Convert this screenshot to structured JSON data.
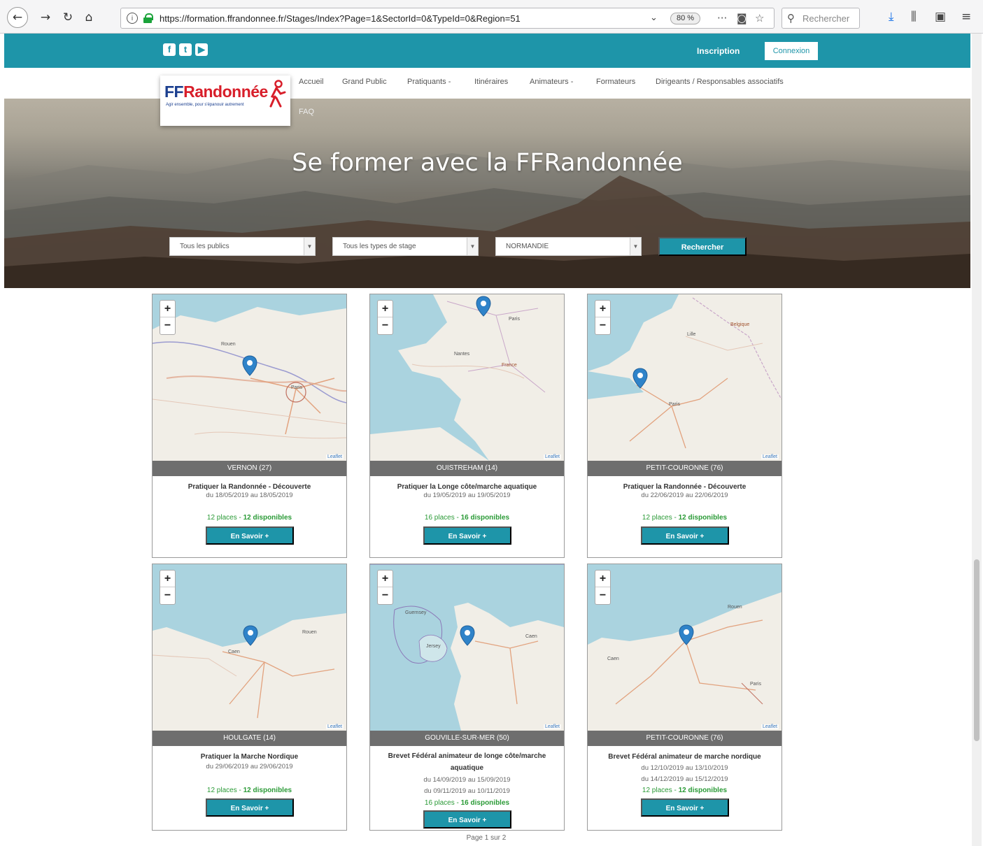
{
  "browser": {
    "url": "https://formation.ffrandonnee.fr/Stages/Index?Page=1&SectorId=0&TypeId=0&Region=51",
    "zoom": "80 %",
    "search_placeholder": "Rechercher"
  },
  "topbar": {
    "inscription": "Inscription",
    "connexion": "Connexion"
  },
  "nav": {
    "items": [
      "Accueil",
      "Grand Public",
      "Pratiquants -",
      "Itinéraires",
      "Animateurs -",
      "Formateurs",
      "Dirigeants / Responsables associatifs"
    ],
    "faq": "FAQ"
  },
  "logo": {
    "brand_ff": "FF",
    "brand_rest": "Randonnée",
    "tagline": "Agir ensemble, pour s'épanouir autrement"
  },
  "hero": {
    "title": "Se former avec la FFRandonnée",
    "filter_public": "Tous les publics",
    "filter_type": "Tous les types de stage",
    "filter_region": "NORMANDIE",
    "search_button": "Rechercher"
  },
  "cards": [
    {
      "location": "VERNON  (27)",
      "title": "Pratiquer la Randonnée - Découverte",
      "dates": [
        "du 18/05/2019 au 18/05/2019"
      ],
      "places": "12 places - ",
      "dispo": "12 disponibles",
      "button": "En Savoir +"
    },
    {
      "location": "OUISTREHAM  (14)",
      "title": "Pratiquer la Longe côte/marche aquatique",
      "dates": [
        "du 19/05/2019 au 19/05/2019"
      ],
      "places": "16 places - ",
      "dispo": "16 disponibles",
      "button": "En Savoir +"
    },
    {
      "location": "PETIT-COURONNE  (76)",
      "title": "Pratiquer la Randonnée - Découverte",
      "dates": [
        "du 22/06/2019 au 22/06/2019"
      ],
      "places": "12 places - ",
      "dispo": "12 disponibles",
      "button": "En Savoir +"
    },
    {
      "location": "HOULGATE  (14)",
      "title": "Pratiquer la Marche Nordique",
      "dates": [
        "du 29/06/2019 au 29/06/2019"
      ],
      "places": "12 places - ",
      "dispo": "12 disponibles",
      "button": "En Savoir +"
    },
    {
      "location": "GOUVILLE-SUR-MER  (50)",
      "title": "Brevet Fédéral animateur de longe côte/marche aquatique",
      "dates": [
        "du 14/09/2019 au 15/09/2019",
        "du 09/11/2019 au 10/11/2019"
      ],
      "places": "16 places - ",
      "dispo": "16 disponibles",
      "button": "En Savoir +"
    },
    {
      "location": "PETIT-COURONNE  (76)",
      "title": "Brevet Fédéral animateur de marche nordique",
      "dates": [
        "du 12/10/2019 au 13/10/2019",
        "du 14/12/2019 au 15/12/2019"
      ],
      "places": "12 places - ",
      "dispo": "12 disponibles",
      "button": "En Savoir +"
    }
  ],
  "map_labels": {
    "leaflet": "Leaflet",
    "cities_1": [
      "Rouen",
      "Paris"
    ],
    "cities_2": [
      "Paris",
      "France",
      "Nantes"
    ],
    "cities_3": [
      "Paris",
      "Lille",
      "Belgique"
    ],
    "cities_4": [
      "Caen",
      "Rouen"
    ],
    "cities_5": [
      "Guernsey",
      "Jersey",
      "Caen"
    ],
    "cities_6": [
      "Caen",
      "Rouen",
      "Paris"
    ]
  },
  "pager": "Page 1 sur 2",
  "colors": {
    "accent": "#1e95a9",
    "green": "#2a9a36",
    "location_bar": "#6e6e6e"
  }
}
